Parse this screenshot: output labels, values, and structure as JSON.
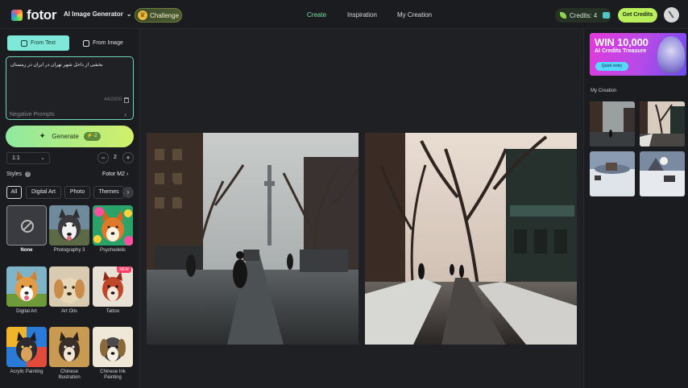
{
  "app": {
    "name": "fotor"
  },
  "header": {
    "generator_menu": "AI Image Generator",
    "challenge": "Challenge",
    "nav": [
      {
        "label": "Create",
        "active": true
      },
      {
        "label": "Inspiration",
        "active": false
      },
      {
        "label": "My Creation",
        "active": false
      }
    ],
    "credits": "Credits: 4",
    "get_credits": "Get Credits"
  },
  "left_panel": {
    "source_tabs": [
      {
        "label": "From Text",
        "active": true
      },
      {
        "label": "From Image",
        "active": false
      }
    ],
    "prompt_value": "بخشی از داخل شهر تهران در ایران در زمستان",
    "prompt_counter": "44/2000",
    "negative_prompts": "Negative Prompts",
    "generate_label": "Generate",
    "generate_cost": "-2",
    "ratio": "1:1",
    "image_count": "2",
    "styles_label": "Styles",
    "model_label": "Fotor M2",
    "filters": [
      {
        "label": "All",
        "active": true
      },
      {
        "label": "Digital Art",
        "active": false
      },
      {
        "label": "Photo",
        "active": false
      },
      {
        "label": "Themes",
        "active": false
      }
    ],
    "styles": [
      {
        "label": "None",
        "selected": true
      },
      {
        "label": "Photography 3",
        "selected": false
      },
      {
        "label": "Psychedelic",
        "selected": false
      },
      {
        "label": "Digital Art",
        "selected": false
      },
      {
        "label": "Art Oils",
        "selected": false
      },
      {
        "label": "Tattoo",
        "selected": false,
        "badge": "NEW"
      },
      {
        "label": "Acrylic Painting",
        "selected": false
      },
      {
        "label": "Chinese Illustration",
        "selected": false
      },
      {
        "label": "Chinese Ink Painting",
        "selected": false
      }
    ]
  },
  "right_panel": {
    "banner": {
      "title": "WIN 10,000",
      "subtitle": "AI Credits Treasure",
      "button": "Quick entry"
    },
    "my_creation_title": "My Creation"
  },
  "colors": {
    "accent": "#7fe8d8",
    "generate_start": "#8fe9a0",
    "generate_end": "#d2f06a",
    "background": "#1c1d20"
  }
}
